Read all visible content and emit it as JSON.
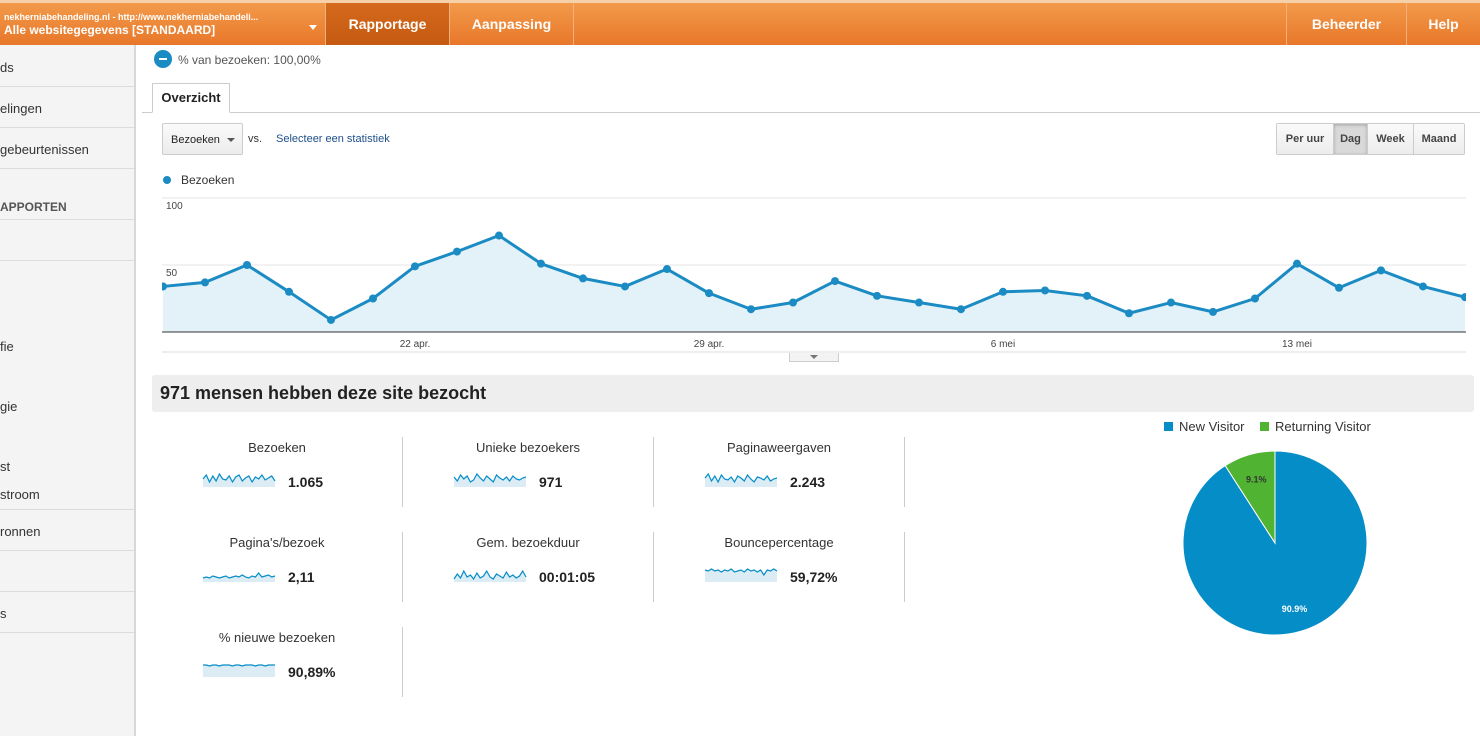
{
  "header": {
    "account_url": "nekherniabehandeling.nl - http://www.nekherniabehandeli...",
    "account_profile": "Alle websitegegevens [STANDAARD]",
    "tabs": [
      "Rapportage",
      "Aanpassing"
    ],
    "right": [
      "Beheerder",
      "Help"
    ]
  },
  "sidebar": {
    "items": [
      "ds",
      "elingen",
      "gebeurtenissen",
      "APPORTEN",
      "fie",
      "gie",
      "st",
      "stroom",
      "ronnen",
      "s"
    ]
  },
  "segment": {
    "label": "% van bezoeken: 100,00%"
  },
  "tab": "Overzicht",
  "controls": {
    "metric": "Bezoeken",
    "vs": "vs.",
    "select_stat": "Selecteer een statistiek",
    "granularity": [
      "Per uur",
      "Dag",
      "Week",
      "Maand"
    ],
    "active": "Dag"
  },
  "chart_data": {
    "type": "area",
    "series": [
      {
        "name": "Bezoeken",
        "values": [
          34,
          37,
          50,
          30,
          9,
          25,
          49,
          60,
          72,
          51,
          40,
          34,
          47,
          29,
          17,
          22,
          38,
          27,
          22,
          17,
          30,
          31,
          27,
          14,
          22,
          15,
          25,
          51,
          33,
          46,
          34,
          26
        ]
      }
    ],
    "x_tick_labels": [
      "22 apr.",
      "29 apr.",
      "6 mei",
      "13 mei"
    ],
    "x_tick_index": [
      6,
      13,
      20,
      27
    ],
    "y_ticks": [
      50,
      100
    ],
    "ylim": [
      0,
      100
    ],
    "color": "#1b8bc3",
    "fill": "#e3f1f8"
  },
  "summary": "971 mensen hebben deze site bezocht",
  "stats": [
    {
      "name": "Bezoeken",
      "value": "1.065"
    },
    {
      "name": "Unieke bezoekers",
      "value": "971"
    },
    {
      "name": "Paginaweergaven",
      "value": "2.243"
    },
    {
      "name": "Pagina's/bezoek",
      "value": "2,11"
    },
    {
      "name": "Gem. bezoekduur",
      "value": "00:01:05"
    },
    {
      "name": "Bouncepercentage",
      "value": "59,72%"
    },
    {
      "name": "% nieuwe bezoeken",
      "value": "90,89%"
    }
  ],
  "pie": {
    "legend": [
      "New Visitor",
      "Returning Visitor"
    ],
    "values": [
      90.9,
      9.1
    ],
    "labels": [
      "90.9%",
      "9.1%"
    ],
    "colors": [
      "#058dc7",
      "#50b432"
    ]
  }
}
